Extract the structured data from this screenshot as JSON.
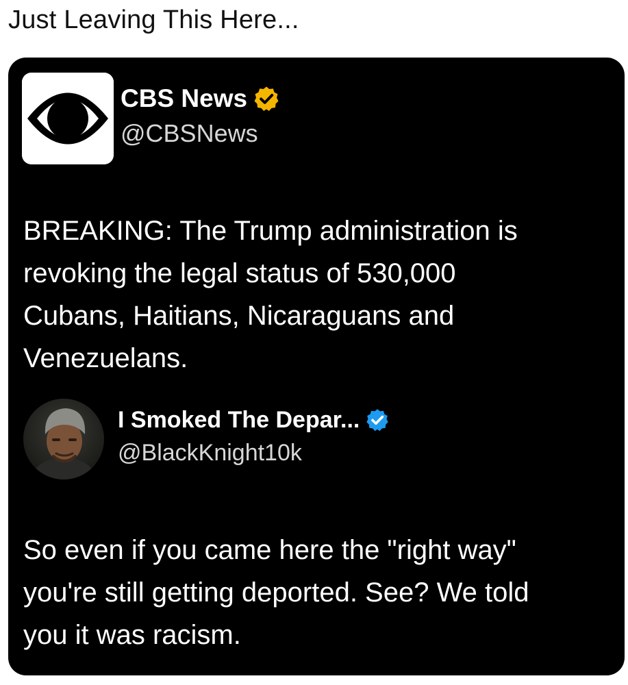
{
  "post": {
    "caption": "Just Leaving This Here..."
  },
  "quoted_tweet": {
    "author": {
      "name": "CBS News",
      "handle": "@CBSNews",
      "avatar_icon": "cbs-eye-logo-icon",
      "verified_badge": "gold-verified-badge-icon"
    },
    "text_lines": [
      "BREAKING: The Trump administration is",
      "revoking the legal status of 530,000",
      "Cubans, Haitians, Nicaraguans and",
      "Venezuelans."
    ]
  },
  "reply_tweet": {
    "author": {
      "name": "I Smoked The Depar...",
      "handle": "@BlackKnight10k",
      "avatar_icon": "user-avatar-photo",
      "verified_badge": "blue-verified-badge-icon"
    },
    "text_lines": [
      "So even if you came here the \"right way\"",
      "you're still getting deported. See? We told",
      "you it was racism."
    ]
  },
  "colors": {
    "card_background": "#000000",
    "page_background": "#ffffff",
    "gold_badge": "#f4b400",
    "blue_badge": "#1d9bf0"
  }
}
